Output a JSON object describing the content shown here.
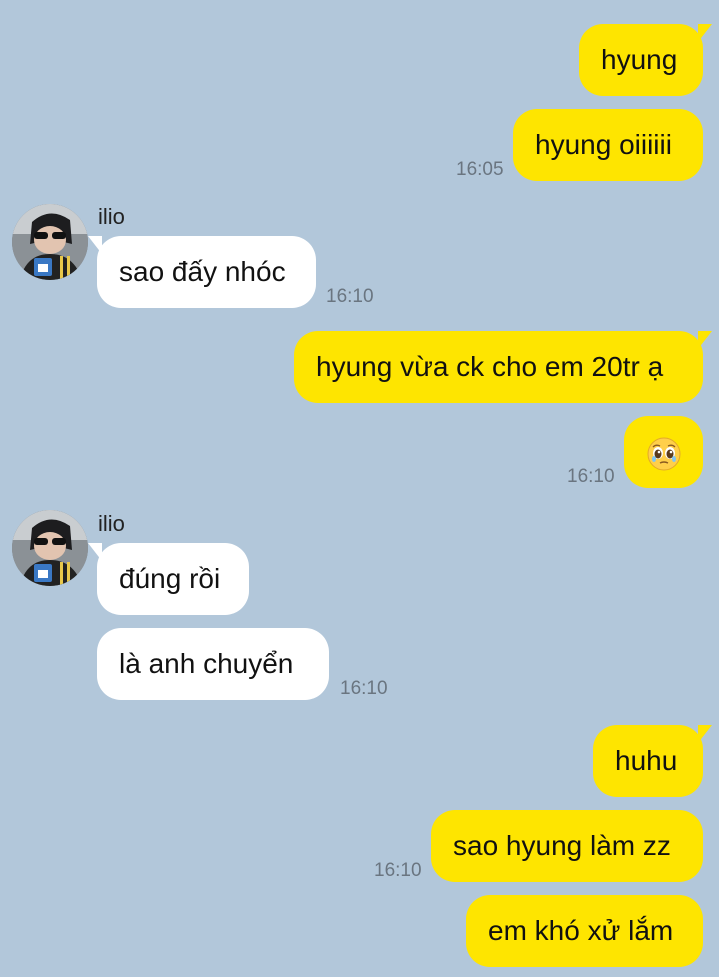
{
  "contact": {
    "name": "ilio"
  },
  "messages": {
    "m1": "hyung",
    "m2": "hyung oiiiiii",
    "m3": "sao đấy nhóc",
    "m4": "hyung vừa ck cho em 20tr ạ",
    "m5_icon": "pleading-face-emoji",
    "m6": "đúng rồi",
    "m7": "là anh chuyển",
    "m8": "huhu",
    "m9": "sao hyung làm zz",
    "m10": "em khó xử lắm"
  },
  "times": {
    "t1": "16:05",
    "t2": "16:10",
    "t3": "16:10",
    "t4": "16:10",
    "t5": "16:10"
  },
  "colors": {
    "background": "#b2c7da",
    "outgoing_bubble": "#fee500",
    "incoming_bubble": "#ffffff",
    "timestamp": "#6a7580"
  }
}
